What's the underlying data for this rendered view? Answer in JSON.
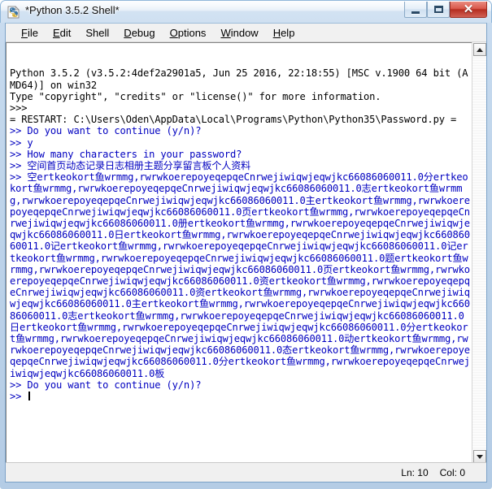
{
  "window": {
    "title": "*Python 3.5.2 Shell*",
    "icon": "python-idle-icon",
    "controls": {
      "minimize": "minimize-button",
      "maximize": "maximize-button",
      "close_glyph": "✕"
    }
  },
  "menubar": {
    "items": [
      {
        "label": "File",
        "mnemonic": "F",
        "rest": "ile"
      },
      {
        "label": "Edit",
        "mnemonic": "E",
        "rest": "dit"
      },
      {
        "label": "Shell",
        "mnemonic": "S",
        "rest": "hell"
      },
      {
        "label": "Debug",
        "mnemonic": "D",
        "rest": "ebug"
      },
      {
        "label": "Options",
        "mnemonic": "O",
        "rest": "ptions"
      },
      {
        "label": "Window",
        "mnemonic": "W",
        "rest": "indow"
      },
      {
        "label": "Help",
        "mnemonic": "H",
        "rest": "elp"
      }
    ]
  },
  "shell": {
    "banner_line_1": "Python 3.5.2 (v3.5.2:4def2a2901a5, Jun 25 2016, 22:18:55) [MSC v.1900 64 bit (AMD64)] on win32",
    "banner_line_2": "Type \"copyright\", \"credits\" or \"license()\" for more information.",
    "prompt_3": ">>>",
    "restart_line": "= RESTART: C:\\Users\\Oden\\AppData\\Local\\Programs\\Python\\Python35\\Password.py =",
    "q_continue_1": ">> Do you want to continue (y/n)?",
    "answer_y": ">> y",
    "q_length": ">> How many characters in your password?",
    "chinese_menu_line": ">> 空间首页动态记录日志相册主题分享留言板个人资料",
    "password_prefix": ">> ",
    "password_token_head": "空",
    "password_unit": "ertkeokort鱼wrmmg,rwrwkoerepoyeqepqeCnrwejiwiqwjeqwjkc66086060011.0",
    "password_separators": [
      "分",
      "志",
      "主",
      "页",
      "册",
      "日",
      "记",
      "记",
      "题",
      "页",
      "资",
      "资",
      "主",
      "志",
      "日",
      "分",
      "动",
      "态",
      "分"
    ],
    "password_tail": "板",
    "q_continue_2": ">> Do you want to continue (y/n)?",
    "final_prompt": ">> "
  },
  "statusbar": {
    "line_label": "Ln: 10",
    "col_label": "Col: 0"
  },
  "colors": {
    "shell_output_blue": "#0000c0",
    "shell_text_black": "#000000",
    "close_button_red": "#b52d20",
    "frame_blue": "#b4cce5"
  },
  "scrollbar": {
    "up_icon": "triangle-up-icon",
    "down_icon": "triangle-down-icon"
  }
}
